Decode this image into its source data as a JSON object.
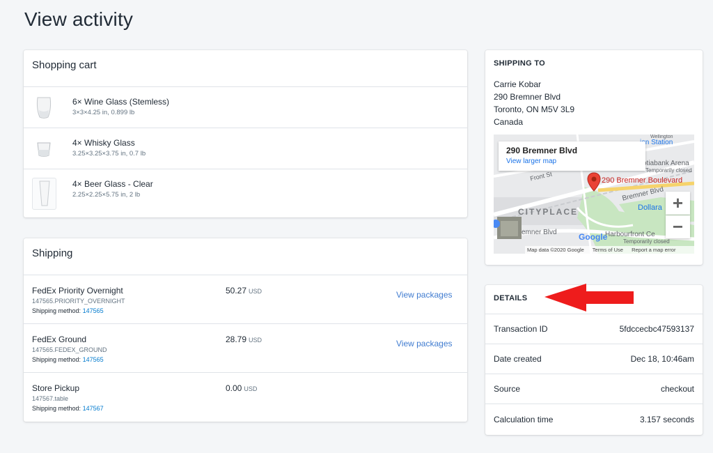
{
  "page": {
    "title": "View activity"
  },
  "cart": {
    "title": "Shopping cart",
    "items": [
      {
        "name": "6× Wine Glass (Stemless)",
        "detail": "3×3×4.25 in, 0.899 lb"
      },
      {
        "name": "4× Whisky Glass",
        "detail": "3.25×3.25×3.75 in, 0.7 lb"
      },
      {
        "name": "4× Beer Glass - Clear",
        "detail": "2.25×2.25×5.75 in, 2 lb"
      }
    ]
  },
  "shipping": {
    "title": "Shipping",
    "method_label": "Shipping method:",
    "rows": [
      {
        "name": "FedEx Priority Overnight",
        "code": "147565.PRIORITY_OVERNIGHT",
        "method_id": "147565",
        "price": "50.27",
        "currency": "USD",
        "link": "View packages"
      },
      {
        "name": "FedEx Ground",
        "code": "147565.FEDEX_GROUND",
        "method_id": "147565",
        "price": "28.79",
        "currency": "USD",
        "link": "View packages"
      },
      {
        "name": "Store Pickup",
        "code": "147567.table",
        "method_id": "147567",
        "price": "0.00",
        "currency": "USD",
        "link": ""
      }
    ]
  },
  "ship_to": {
    "title": "SHIPPING TO",
    "name": "Carrie Kobar",
    "street": "290 Bremner Blvd",
    "city": "Toronto, ON M5V 3L9",
    "country": "Canada",
    "map": {
      "popup_title": "290 Bremner Blvd",
      "popup_link": "View larger map",
      "pin_label": "290 Bremner Boulevard",
      "labels": [
        "ion Station",
        "otiabank Arena",
        "Temporarily closed",
        "Bremner Blvd",
        "Dollara",
        "CITYPLACE",
        "Front St",
        "Harbourfront Ce",
        "Temporarily closed",
        "emner Blvd",
        "Wellington"
      ],
      "attribution": [
        "Map data ©2020 Google",
        "Terms of Use",
        "Report a map error"
      ],
      "google_logo": "Google",
      "zoom_in": "+",
      "zoom_out": "−"
    }
  },
  "details": {
    "title": "DETAILS",
    "rows": [
      {
        "label": "Transaction ID",
        "value": "5fdccecbc47593137"
      },
      {
        "label": "Date created",
        "value": "Dec 18, 10:46am"
      },
      {
        "label": "Source",
        "value": "checkout"
      },
      {
        "label": "Calculation time",
        "value": "3.157 seconds"
      }
    ]
  },
  "colors": {
    "accent": "#007ace",
    "arrow": "#ee1c1c",
    "pin": "#ea4335"
  }
}
